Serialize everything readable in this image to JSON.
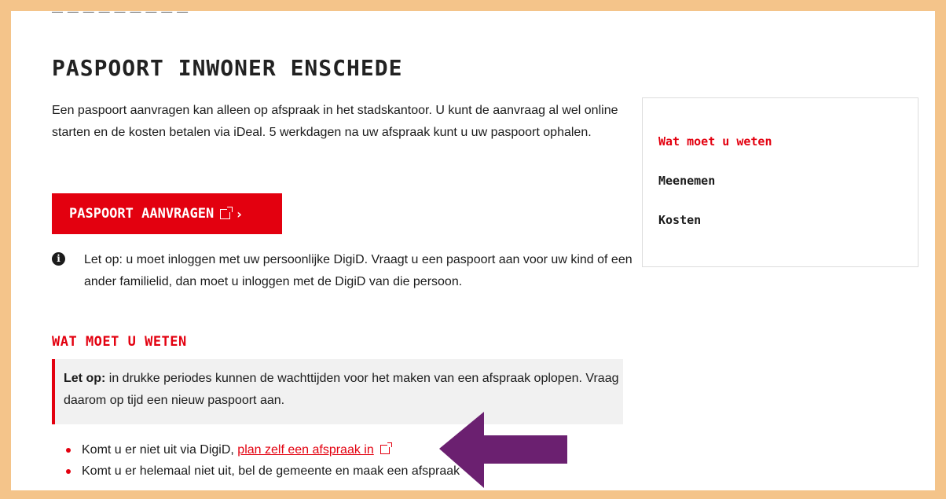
{
  "page": {
    "title": "PASPOORT INWONER ENSCHEDE",
    "intro": "Een paspoort aanvragen kan alleen op afspraak in het stadskantoor. U kunt de aanvraag al wel online starten en de kosten betalen via iDeal. 5 werkdagen na uw afspraak kunt u uw paspoort ophalen.",
    "apply_button": "PASPOORT AANVRAGEN",
    "info_text": "Let op: u moet inloggen met uw persoonlijke DigiD. Vraagt u een paspoort aan voor uw kind of een ander familielid, dan moet u inloggen met de DigiD van die persoon.",
    "section_heading": "WAT MOET U WETEN",
    "notice_bold": "Let op:",
    "notice_text": " in drukke periodes kunnen de wachttijden voor het maken van een afspraak oplopen. Vraag daarom op tijd een nieuw paspoort aan.",
    "bullet1_prefix": "Komt u er niet uit via DigiD, ",
    "bullet1_link": "plan zelf een afspraak in",
    "bullet2": "Komt u er helemaal niet uit, bel de gemeente en maak een afspraak"
  },
  "sidebar": {
    "items": [
      {
        "label": "Wat moet u weten",
        "active": true
      },
      {
        "label": "Meenemen",
        "active": false
      },
      {
        "label": "Kosten",
        "active": false
      }
    ]
  },
  "colors": {
    "accent": "#e3000f",
    "frame": "#f4c48a",
    "arrow": "#6b2070"
  },
  "icons": {
    "info": "info-icon",
    "external": "external-link-icon",
    "chevron": "chevron-right-icon",
    "annotation": "arrow-left-annotation"
  }
}
